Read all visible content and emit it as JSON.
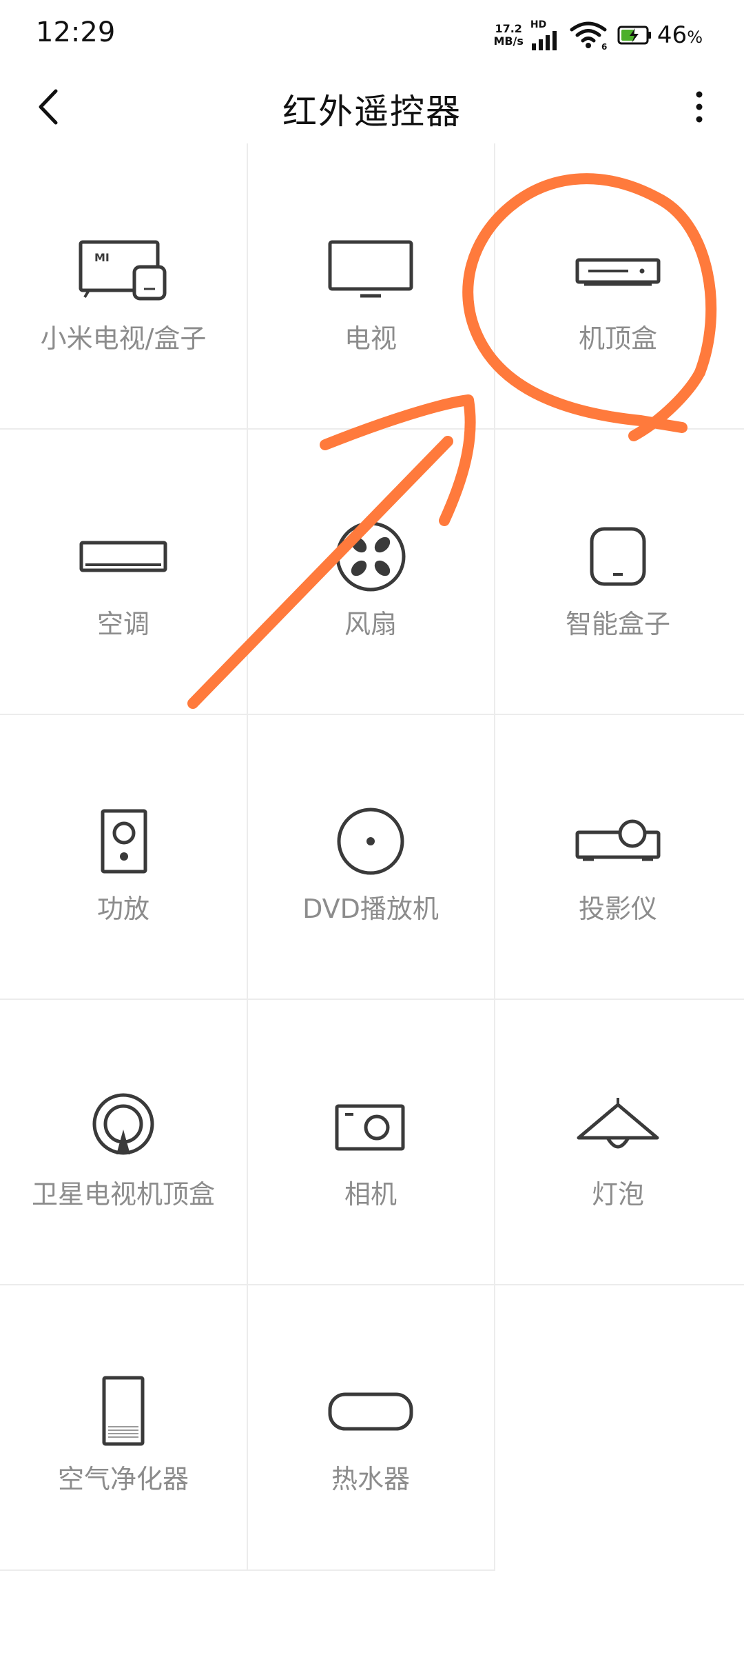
{
  "status_bar": {
    "time": "12:29",
    "net_speed_value": "17.2",
    "net_speed_unit": "MB/s",
    "hd_label": "HD",
    "battery_percent": "46",
    "battery_suffix": "%",
    "wifi_badge": "6"
  },
  "header": {
    "title": "红外遥控器"
  },
  "devices": [
    {
      "label": "小米电视/盒子",
      "icon": "mi-tv-box-icon"
    },
    {
      "label": "电视",
      "icon": "tv-icon"
    },
    {
      "label": "机顶盒",
      "icon": "set-top-box-icon"
    },
    {
      "label": "空调",
      "icon": "air-conditioner-icon"
    },
    {
      "label": "风扇",
      "icon": "fan-icon"
    },
    {
      "label": "智能盒子",
      "icon": "smart-box-icon"
    },
    {
      "label": "功放",
      "icon": "amplifier-icon"
    },
    {
      "label": "DVD播放机",
      "icon": "dvd-player-icon"
    },
    {
      "label": "投影仪",
      "icon": "projector-icon"
    },
    {
      "label": "卫星电视机顶盒",
      "icon": "satellite-tv-box-icon"
    },
    {
      "label": "相机",
      "icon": "camera-icon"
    },
    {
      "label": "灯泡",
      "icon": "light-bulb-icon"
    },
    {
      "label": "空气净化器",
      "icon": "air-purifier-icon"
    },
    {
      "label": "热水器",
      "icon": "water-heater-icon"
    }
  ],
  "colors": {
    "icon_stroke": "#3a3a3a",
    "label_gray": "#8c8c8c",
    "divider": "#ececec",
    "annotation_orange": "#ff7a3c",
    "battery_green": "#4caf2a"
  }
}
